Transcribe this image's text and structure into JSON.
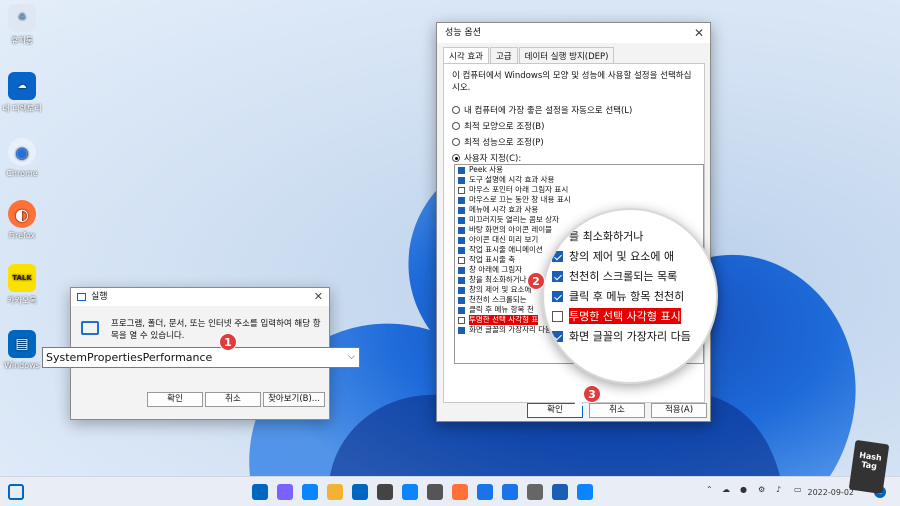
{
  "desktop": {
    "icons": [
      {
        "label": "휴지통",
        "glyph": "♻",
        "color": "#5b9bd5"
      },
      {
        "label": "내 디렉토리",
        "glyph": "☁",
        "color": "#0a64c8"
      },
      {
        "label": "Chrome",
        "glyph": "◉",
        "color": "#1a73e8"
      },
      {
        "label": "Firefox",
        "glyph": "◐",
        "color": "#ff7139"
      },
      {
        "label": "카카오톡",
        "glyph": "TALK",
        "color": "#fae100"
      },
      {
        "label": "Windows",
        "glyph": "▤",
        "color": "#0067c0"
      }
    ]
  },
  "perf_dialog": {
    "title": "성능 옵션",
    "tabs": [
      "시각 효과",
      "고급",
      "데이터 실행 방지(DEP)"
    ],
    "description": "이 컴퓨터에서 Windows의 모양 및 성능에 사용할 설정을 선택하십시오.",
    "radios": [
      {
        "label": "내 컴퓨터에 가장 좋은 설정을 자동으로 선택(L)",
        "checked": false
      },
      {
        "label": "최적 모양으로 조정(B)",
        "checked": false
      },
      {
        "label": "최적 성능으로 조정(P)",
        "checked": false
      },
      {
        "label": "사용자 지정(C):",
        "checked": true
      }
    ],
    "options": [
      {
        "label": "Peek 사용",
        "checked": true
      },
      {
        "label": "도구 설명에 시각 효과 사용",
        "checked": true
      },
      {
        "label": "마우스 포인터 아래 그림자 표시",
        "checked": false
      },
      {
        "label": "마우스로 끄는 동안 창 내용 표시",
        "checked": true
      },
      {
        "label": "메뉴에 시각 효과 사용",
        "checked": true
      },
      {
        "label": "미끄러지듯 열리는 콤보 상자",
        "checked": true
      },
      {
        "label": "바탕 화면의 아이콘 레이블",
        "checked": true
      },
      {
        "label": "아이콘 대신 미리 보기",
        "checked": true
      },
      {
        "label": "작업 표시줄 애니메이션",
        "checked": true
      },
      {
        "label": "작업 표시줄 축",
        "checked": false
      },
      {
        "label": "창 아래에 그림자",
        "checked": true
      },
      {
        "label": "창을 최소화하거나",
        "checked": true
      },
      {
        "label": "창의 제어 및 요소에",
        "checked": true
      },
      {
        "label": "천천히 스크롤되는",
        "checked": true
      },
      {
        "label": "클릭 후 메뉴 항목 천",
        "checked": true
      },
      {
        "label": "투명한 선택 사각형 표",
        "checked": false,
        "highlight": true
      },
      {
        "label": "화면 글꼴의 가장자리 다듬",
        "checked": true
      }
    ],
    "buttons": {
      "ok": "확인",
      "cancel": "취소",
      "apply": "적용(A)"
    }
  },
  "magnifier": {
    "rows": [
      {
        "label": "를 최소화하거나",
        "checked": true
      },
      {
        "label": "창의 제어 및 요소에 애",
        "checked": true
      },
      {
        "label": "천천히 스크롤되는 목록 ",
        "checked": true
      },
      {
        "label": "클릭 후 메뉴 항목 천천히",
        "checked": true
      },
      {
        "label": "투명한 선택 사각형 표시",
        "checked": false,
        "highlight": true
      },
      {
        "label": "화면 글꼴의 가장자리 다듬",
        "checked": true
      }
    ]
  },
  "steps": [
    "1",
    "2",
    "3"
  ],
  "run_dialog": {
    "title": "실행",
    "message": "프로그램, 폴더, 문서, 또는 인터넷 주소를 입력하여 해당 항목을 열 수 있습니다.",
    "input_value": "SystemPropertiesPerformance",
    "buttons": {
      "ok": "확인",
      "cancel": "취소",
      "browse": "찾아보기(B)..."
    }
  },
  "taskbar": {
    "date": "2022-09-02",
    "badge": "2",
    "app_colors": [
      "#0067c0",
      "#7b61ff",
      "#0a84ff",
      "#f2b233",
      "#0067c0",
      "#444",
      "#0a84ff",
      "#555",
      "#ff7139",
      "#1a73e8",
      "#1a73e8",
      "#666",
      "#1a5fb4",
      "#0a84ff"
    ]
  },
  "watermark": "Hash Tag"
}
